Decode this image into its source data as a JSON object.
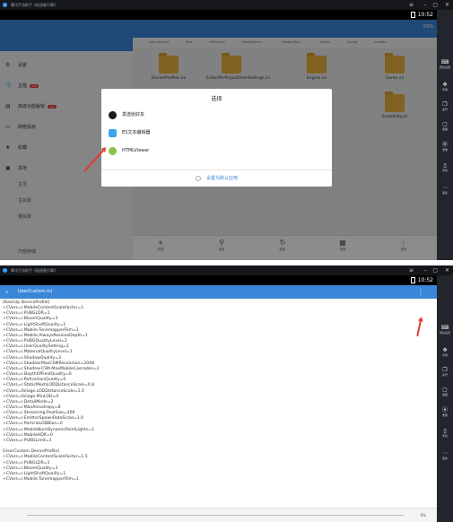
{
  "window_title": "腾讯手游助手【极速傲引擎】",
  "status_time": "10:52",
  "right_toolbar": [
    {
      "icon": "keyboard-icon",
      "label": "键位设置",
      "glyph": "⌨"
    },
    {
      "icon": "gamepad-icon",
      "label": "手柄",
      "glyph": "✥"
    },
    {
      "icon": "multi-window-icon",
      "label": "多开",
      "glyph": "❐"
    },
    {
      "icon": "screenshot-icon",
      "label": "截图",
      "glyph": "▢"
    },
    {
      "icon": "record-icon",
      "label": "录像",
      "glyph": "⦿"
    },
    {
      "icon": "phone-icon",
      "label": "手机",
      "glyph": "▯"
    },
    {
      "icon": "more-icon",
      "label": "更多",
      "glyph": "⋯"
    }
  ],
  "drawer": {
    "items": [
      {
        "icon": "settings-icon",
        "glyph": "⚙",
        "label": "设置",
        "badge": ""
      },
      {
        "icon": "theme-icon",
        "glyph": "👕",
        "label": "主题",
        "badge": "new"
      },
      {
        "icon": "advanced-icon",
        "glyph": "▤",
        "label": "高级功能解锁",
        "badge": "new"
      },
      {
        "icon": "cast-icon",
        "glyph": "▭",
        "label": "网络投射",
        "badge": ""
      },
      {
        "icon": "star-icon",
        "glyph": "★",
        "label": "收藏",
        "badge": ""
      },
      {
        "icon": "local-icon",
        "glyph": "▣",
        "label": "本地",
        "badge": ""
      }
    ],
    "subitems": [
      "主页",
      "主目录",
      "根目录"
    ],
    "footer": "内部存储"
  },
  "file_manager": {
    "path_segments": [
      "com.tencent",
      "files",
      "UE4Game",
      "ShadowTrac...",
      "ShadowTrac...",
      "Saved",
      "Config",
      "Android"
    ],
    "percent": "59%",
    "files": [
      "DeviceProfiles.ini",
      "EditorPerProjectUserSettings.ini",
      "Engine.ini",
      "Game.ini",
      "Scalability.ini"
    ],
    "bottom_actions": [
      {
        "icon": "new-icon",
        "glyph": "+",
        "label": "新建"
      },
      {
        "icon": "search-icon",
        "glyph": "⚲",
        "label": "搜索"
      },
      {
        "icon": "refresh-icon",
        "glyph": "↻",
        "label": "刷新"
      },
      {
        "icon": "view-icon",
        "glyph": "▦",
        "label": "视图"
      },
      {
        "icon": "more-vert-icon",
        "glyph": "⋮",
        "label": "更多"
      }
    ]
  },
  "chooser_dialog": {
    "title": "选择",
    "options": [
      {
        "icon": "qq-icon",
        "label": "发送给好友",
        "color": "#1a1a1a"
      },
      {
        "icon": "es-editor-icon",
        "label": "ES文本编辑器",
        "color": "#3aa6e8"
      },
      {
        "icon": "htmlviewer-icon",
        "label": "HTMLViewer",
        "color": "#8bc34a"
      }
    ],
    "set_default": "设置为默认应用"
  },
  "editor": {
    "title": "UserCustom.ini",
    "lines": [
      "[BackUp DeviceProfile]",
      "+CVars=r.MobileContentScaleFactor=1",
      "+CVars=r.PUBGLDR=1",
      "+CVars=r.BloomQuality=3",
      "+CVars=r.LightShaftQuality=1",
      "+CVars=r.Mobile.TonemapperFilm=1",
      "+CVars=r.Mobile.AlwaysResolveDepth=1",
      "+CVars=r.PUBGQualityLevel=2",
      "+CVars=r.UserQualitySetting=2",
      "+CVars=r.MaterialQualityLevel=1",
      "+CVars=r.ShadowQuality=3",
      "+CVars=r.Shadow.MaxCSMResolution=2048",
      "+CVars=r.Shadow.CSM.MaxMobileCascades=2",
      "+CVars=r.DepthOfFieldQuality=0",
      "+CVars=r.RefractionQuality=0",
      "+CVars=r.StaticMeshLODDistanceScale=0.8",
      "+CVars=foliage.LODDistanceScale=1.0",
      "+CVars=foliage.MinLOD=0",
      "+CVars=r.DetailMode=2",
      "+CVars=r.MaxAnisotropy=8",
      "+CVars=r.Streaming.PoolSize=300",
      "+CVars=r.EmitterSpawnRateScale=1.0",
      "+CVars=r.ParticleLODBias=0",
      "+CVars=r.MobileNumDynamicPointLights=1",
      "+CVars=r.MobileHDR=0",
      "+CVars=r.PUBGLimit=1",
      "",
      "[UserCustom DeviceProfile]",
      "+CVars=r.MobileContentScaleFactor=1.5",
      "+CVars=r.PUBGLDR=1",
      "+CVars=r.BloomQuality=3",
      "+CVars=r.LightShaftQuality=1",
      "+CVars=r.Mobile.TonemapperFilm=1"
    ],
    "scroll_percent": "0%"
  }
}
